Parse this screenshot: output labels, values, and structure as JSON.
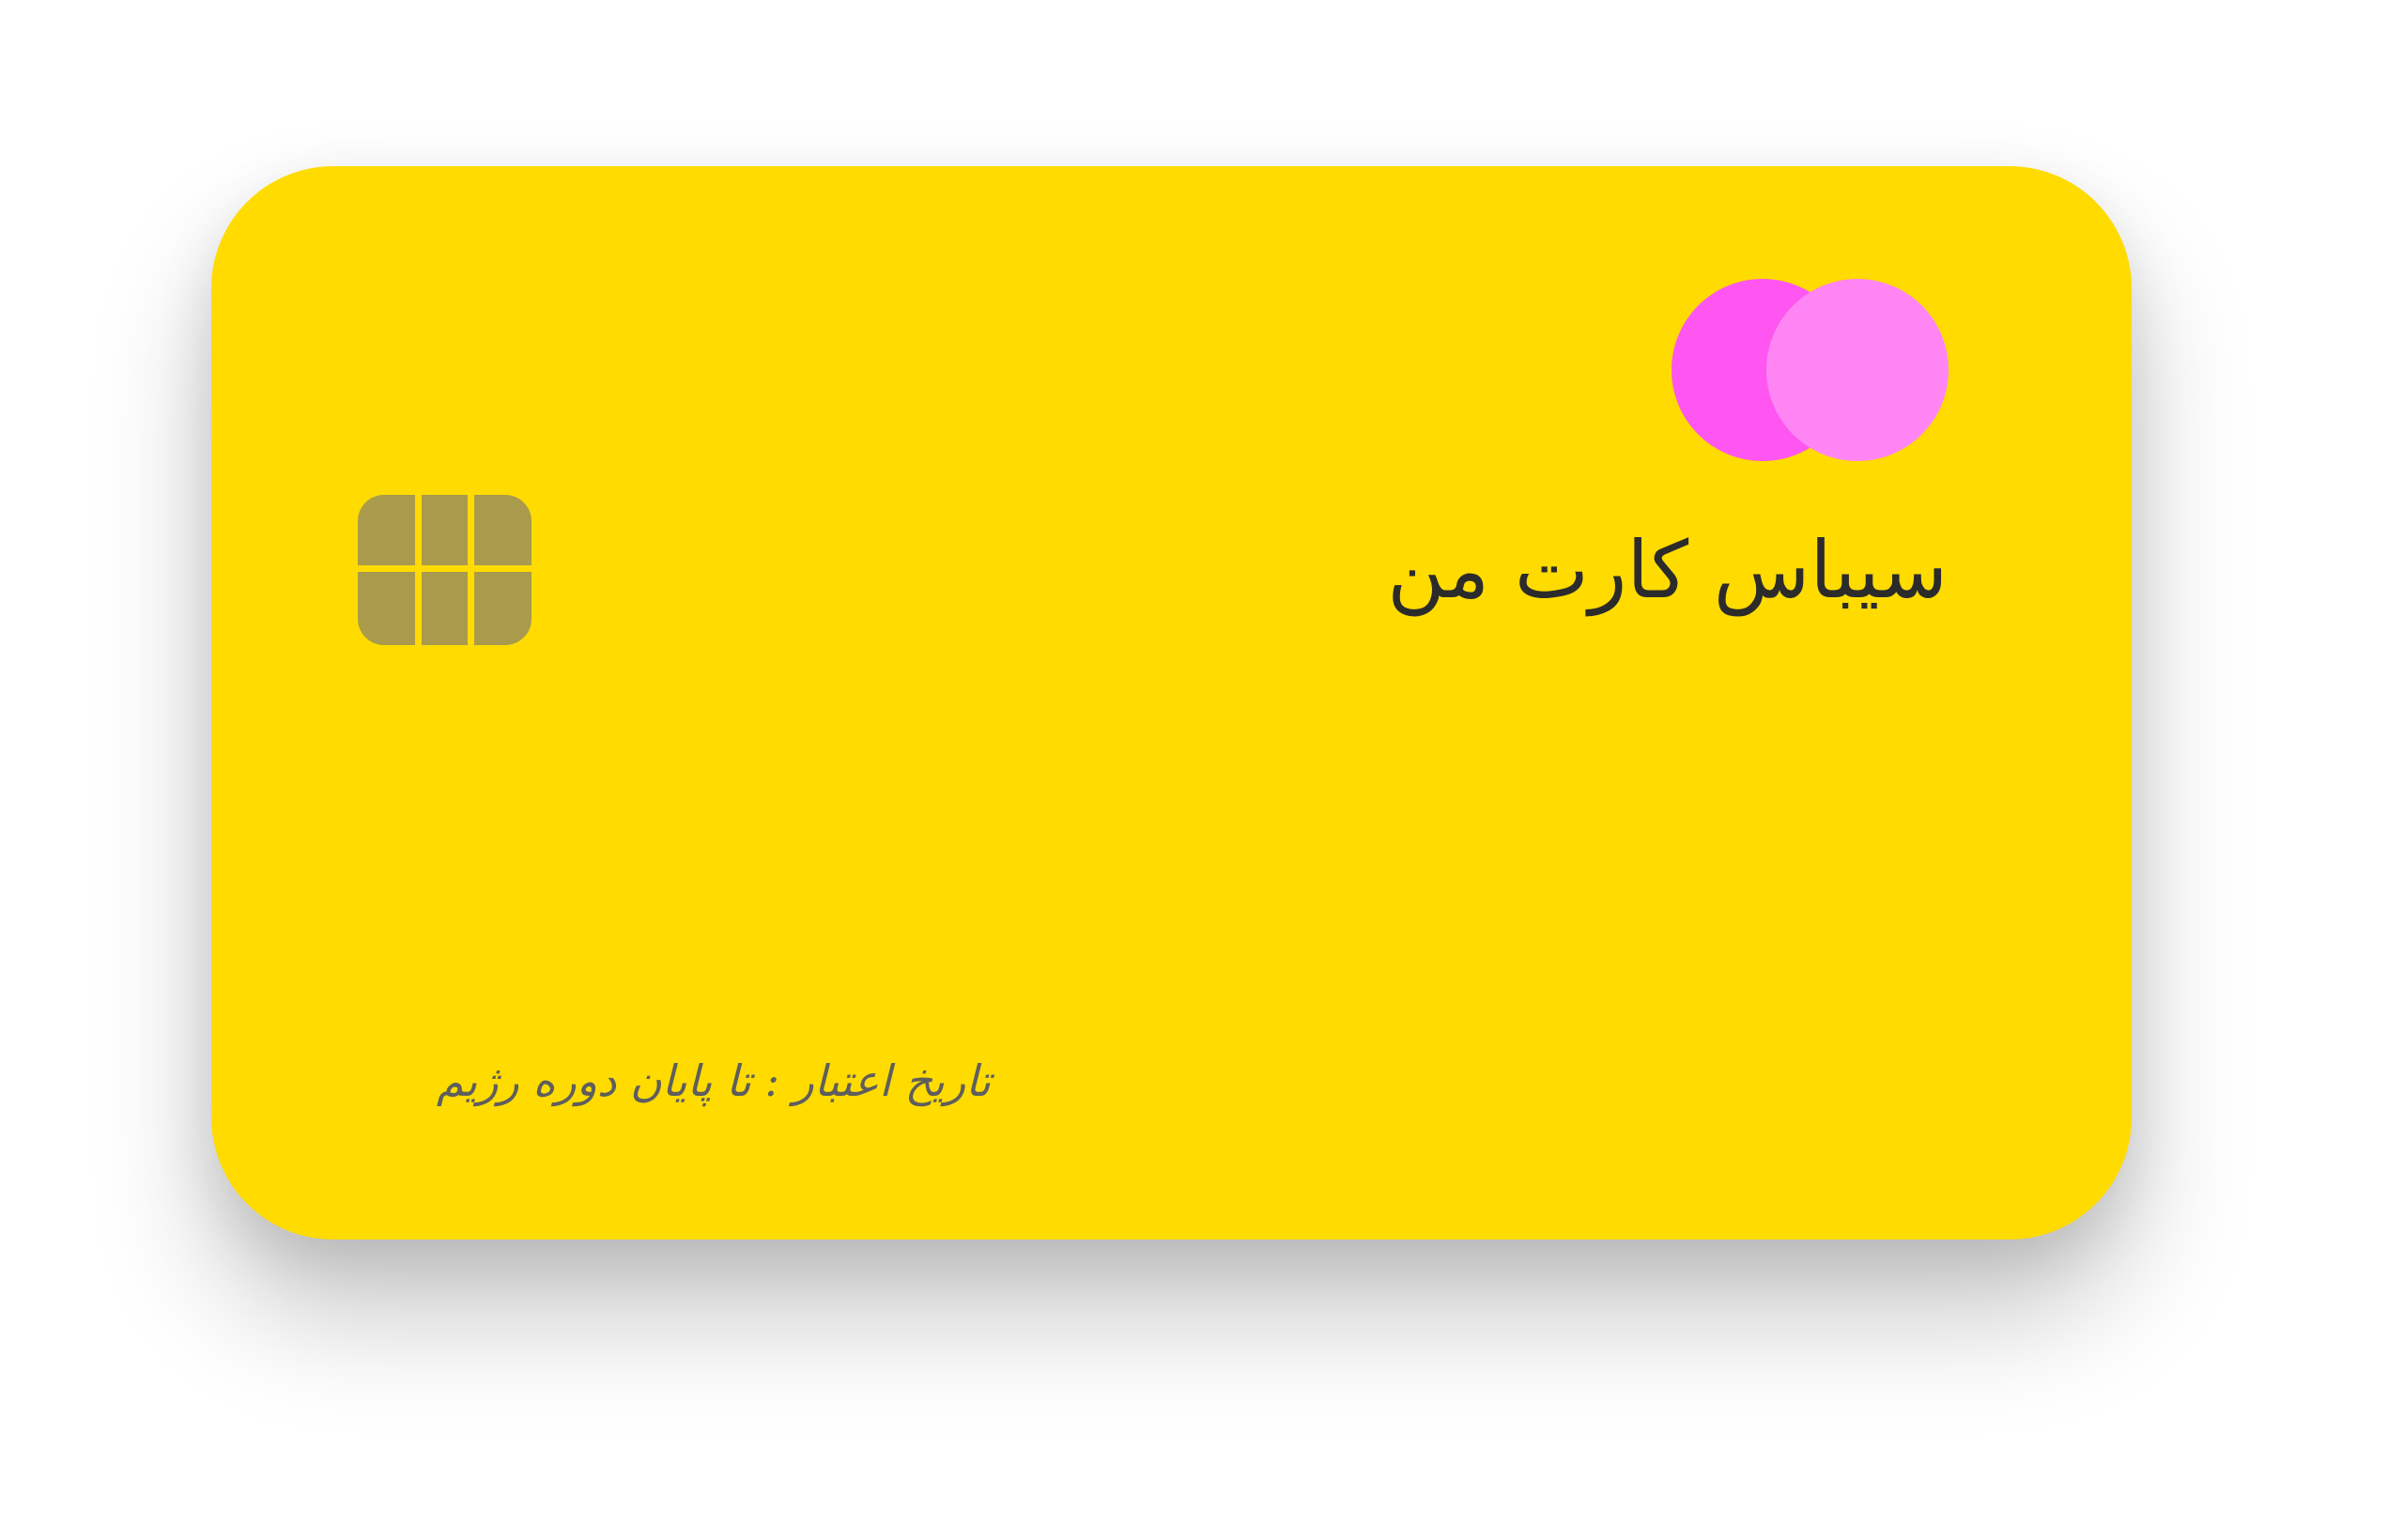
{
  "card": {
    "title": "سیباس کارت من",
    "expiry": "تاریخ اعتبار : تا پایان دوره رژیم",
    "icons": {
      "brand": "brand-logo-icon",
      "chip": "chip-icon"
    },
    "colors": {
      "background": "#ffdb00",
      "brand_left": "#ff55f1",
      "brand_right": "#ff85f5",
      "chip": "#aa9a4b",
      "title_text": "#2b2b2b",
      "expiry_text": "#5e5e5e"
    }
  }
}
